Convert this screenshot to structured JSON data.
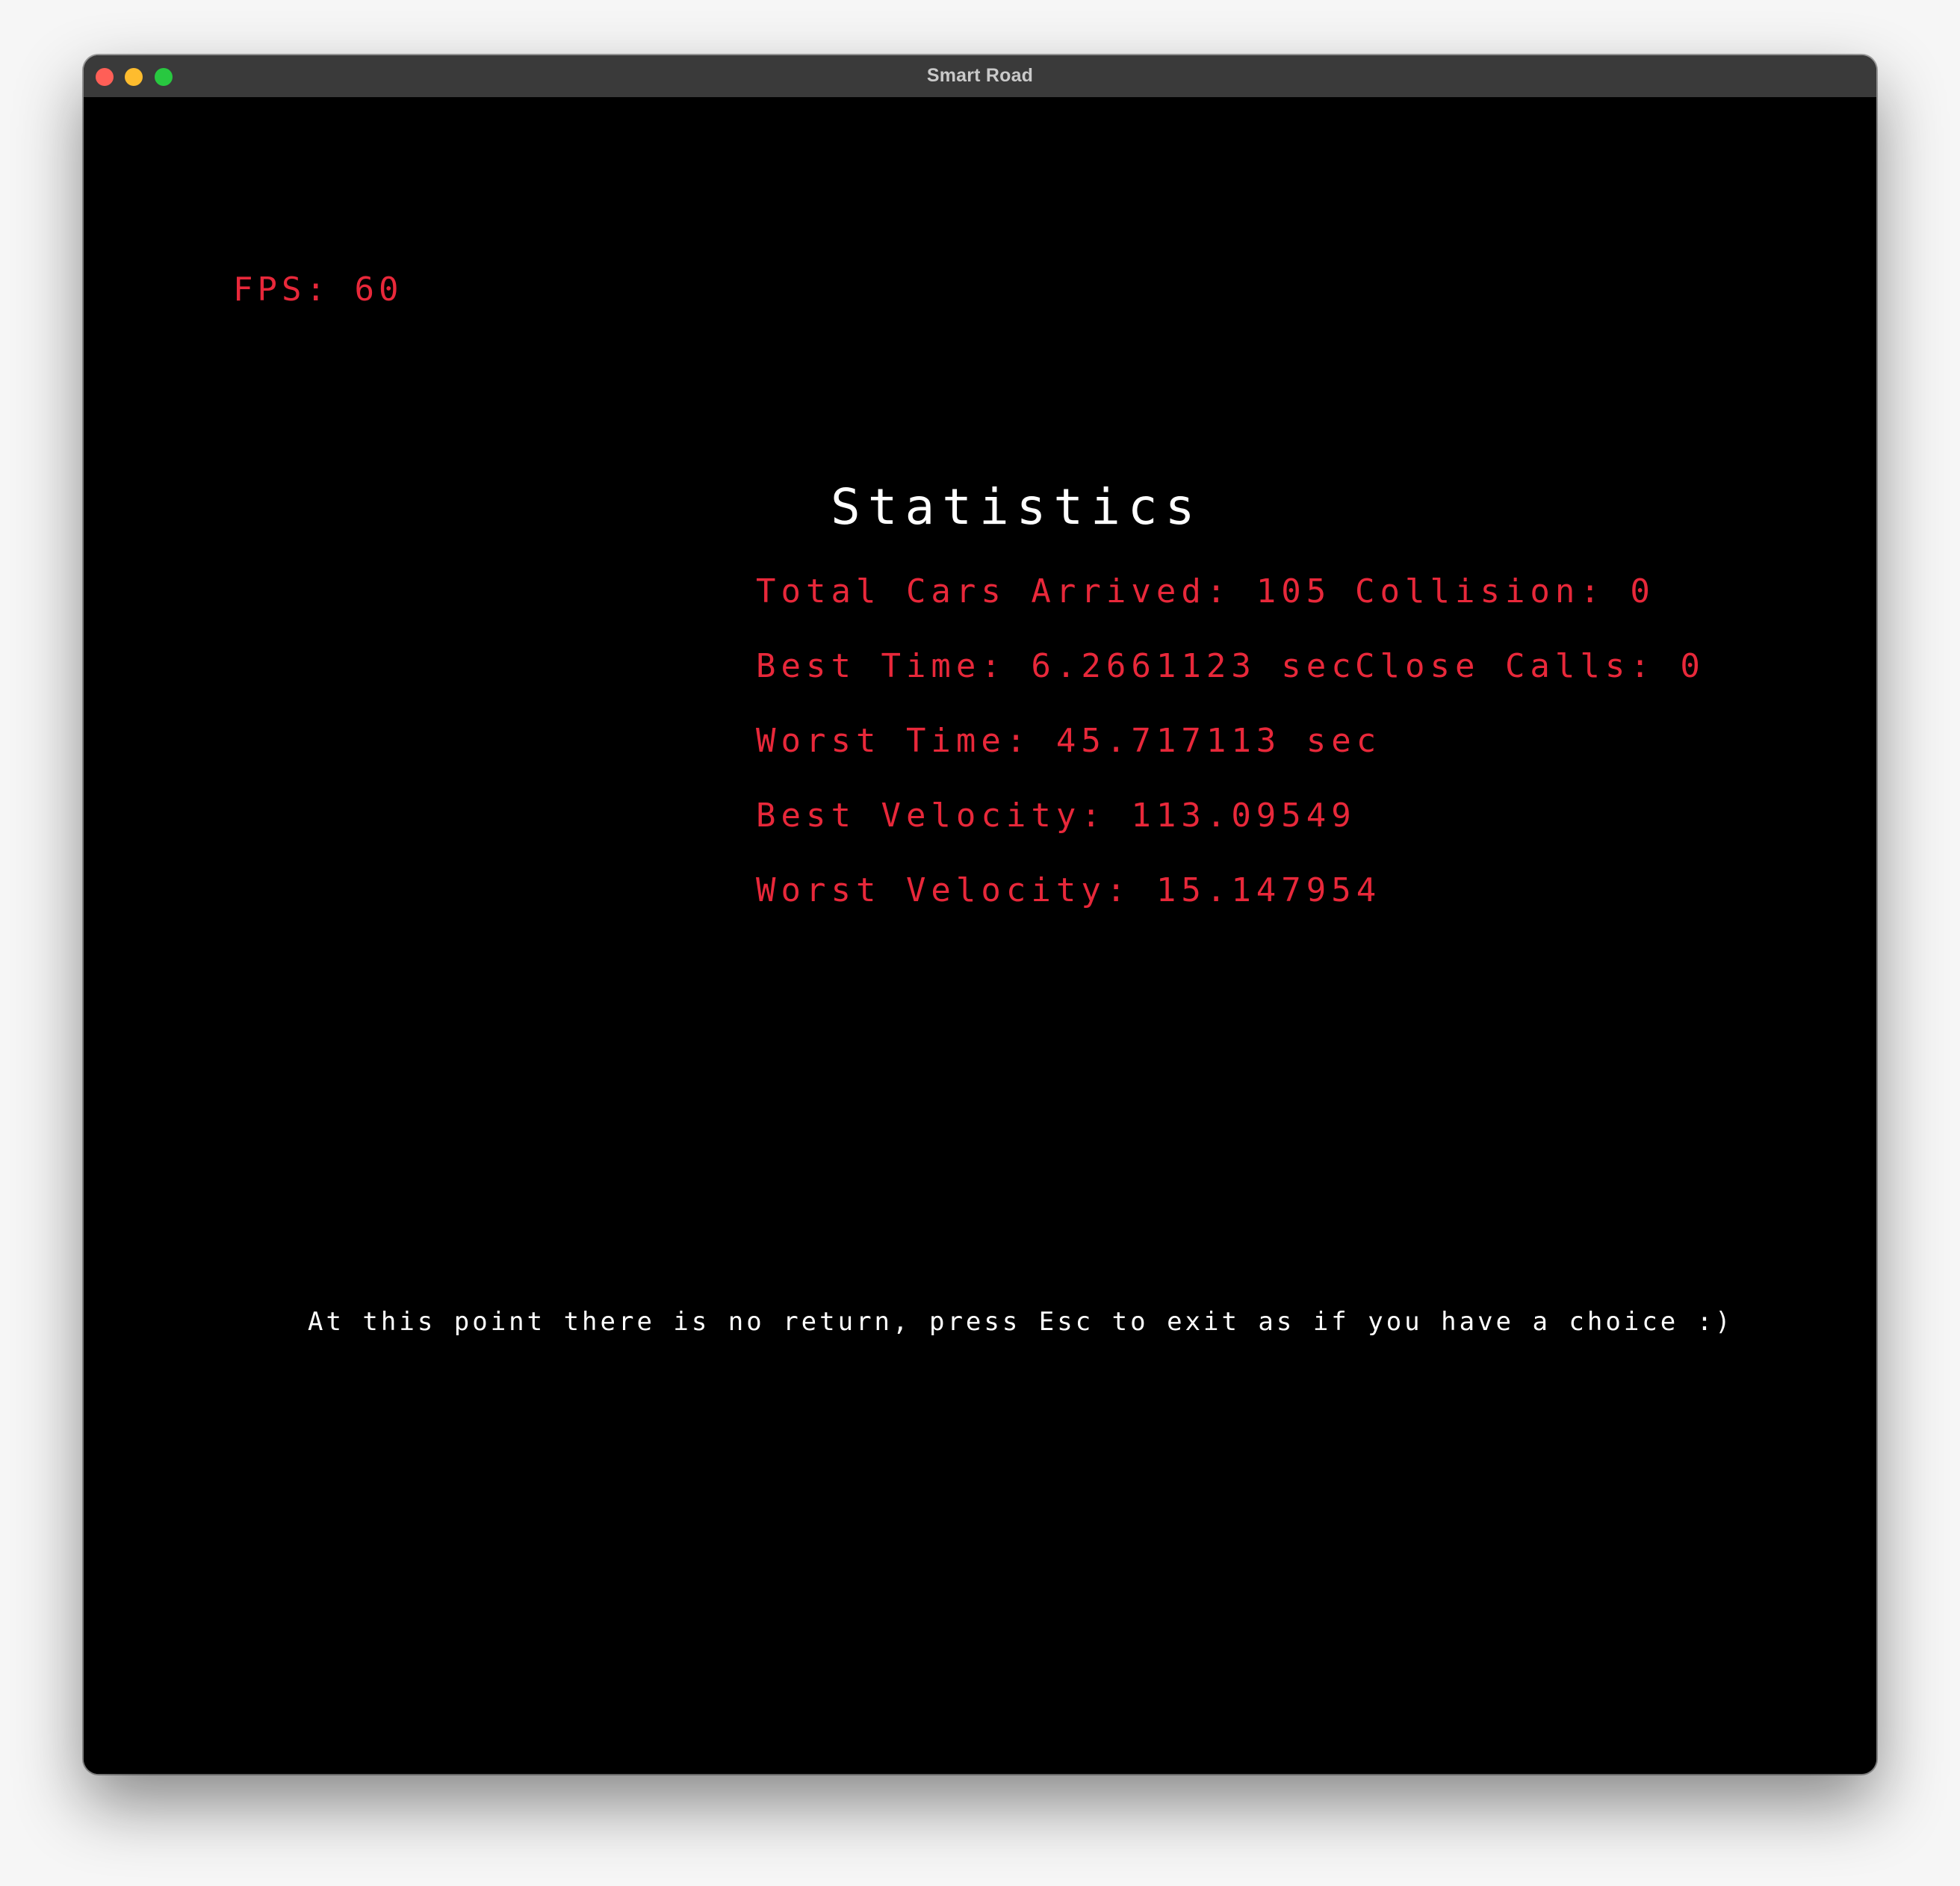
{
  "window": {
    "title": "Smart Road"
  },
  "colors": {
    "accent": "#e8283a",
    "window_close": "#ff5f57",
    "window_minimize": "#febc2e",
    "window_zoom": "#28c840"
  },
  "hud": {
    "fps_text": "FPS: 60"
  },
  "statistics": {
    "title": "Statistics",
    "total_cars_arrived": "Total Cars Arrived: 105",
    "best_time": "Best Time: 6.2661123 sec",
    "worst_time": "Worst Time: 45.717113 sec",
    "best_velocity": "Best Velocity: 113.09549",
    "worst_velocity": "Worst Velocity: 15.147954",
    "collision": "Collision: 0",
    "close_calls": "Close Calls: 0"
  },
  "footer": {
    "message": "At this point there is no return, press Esc to exit as if you have a choice :)"
  }
}
